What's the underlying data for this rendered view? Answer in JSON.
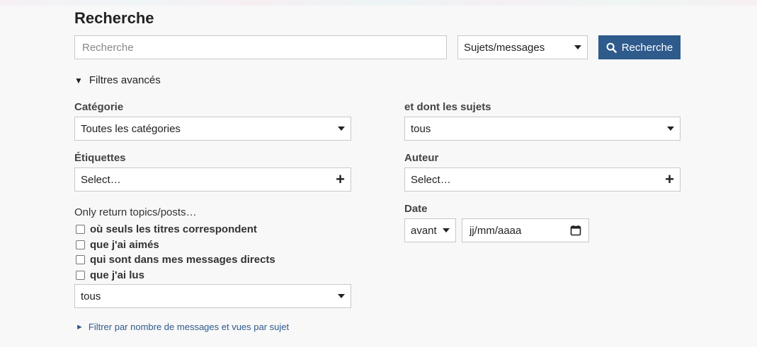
{
  "page": {
    "title": "Recherche"
  },
  "search": {
    "placeholder": "Recherche",
    "type_select": "Sujets/messages",
    "button_label": "Recherche"
  },
  "advanced": {
    "toggle_label": "Filtres avancés",
    "category": {
      "label": "Catégorie",
      "value": "Toutes les catégories"
    },
    "tags": {
      "label": "Étiquettes",
      "value": "Select…"
    },
    "only_return": {
      "label": "Only return topics/posts…",
      "options": [
        "où seuls les titres correspondent",
        "que j'ai aimés",
        "qui sont dans mes messages directs",
        "que j'ai lus"
      ],
      "select_value": "tous"
    },
    "topics_status": {
      "label": "et dont les sujets",
      "value": "tous"
    },
    "author": {
      "label": "Auteur",
      "value": "Select…"
    },
    "date": {
      "label": "Date",
      "when": "avant",
      "placeholder": "jj/mm/aaaa"
    },
    "more_filters_label": "Filtrer par nombre de messages et vues par sujet"
  },
  "colors": {
    "primary": "#2e5a8c",
    "background": "#f8f8f8",
    "border": "#c8c8c8"
  },
  "icons": [
    "search-icon",
    "caret-down-icon",
    "plus-icon",
    "calendar-icon",
    "triangle-down-icon",
    "triangle-right-icon"
  ]
}
